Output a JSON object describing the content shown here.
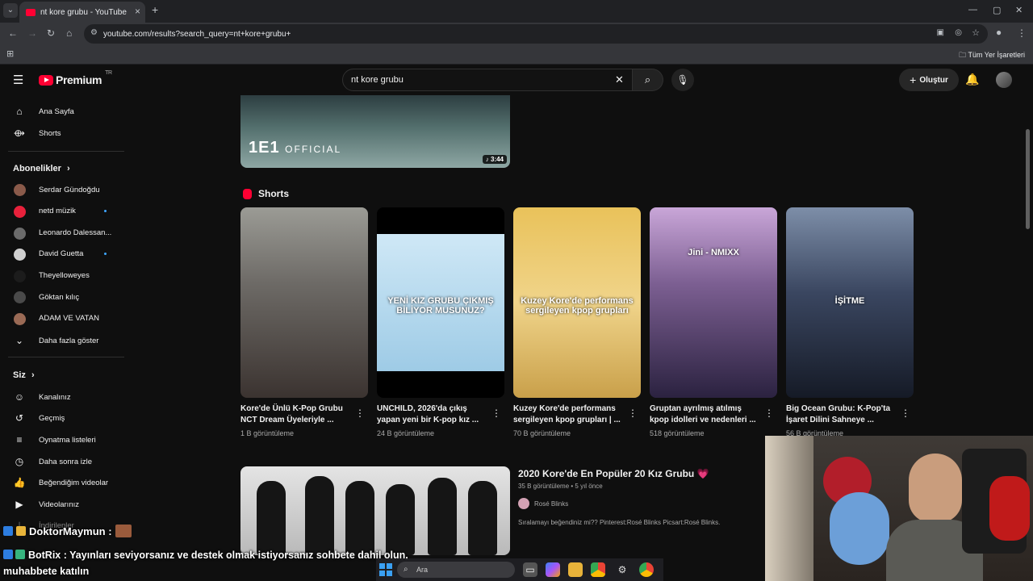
{
  "browser": {
    "tab_title": "nt kore grubu - YouTube",
    "new_tab": "+",
    "url": "youtube.com/results?search_query=nt+kore+grubu+",
    "bookmarks_all": "Tüm Yer İşaretleri"
  },
  "masthead": {
    "logo_text": "Premium",
    "logo_sup": "TR",
    "search_value": "nt kore grubu",
    "create_label": "Oluştur"
  },
  "sidebar": {
    "main": [
      {
        "label": "Ana Sayfa",
        "icon": "home-icon"
      },
      {
        "label": "Shorts",
        "icon": "shorts-icon"
      }
    ],
    "subs_title": "Abonelikler",
    "subscriptions": [
      {
        "label": "Serdar Gündoğdu",
        "color": "#8a5a4a",
        "dot": false
      },
      {
        "label": "netd müzik",
        "color": "#e8213b",
        "dot": true
      },
      {
        "label": "Leonardo Dalessan...",
        "color": "#6b6b6b",
        "dot": false
      },
      {
        "label": "David Guetta",
        "color": "#d0d0d0",
        "dot": true
      },
      {
        "label": "Theyelloweyes",
        "color": "#1c1c1c",
        "dot": false
      },
      {
        "label": "Göktan kılıç",
        "color": "#4a4a4a",
        "dot": false
      },
      {
        "label": "ADAM VE VATAN",
        "color": "#9a6a55",
        "dot": false
      }
    ],
    "show_more": "Daha fazla göster",
    "you_title": "Siz",
    "you": [
      {
        "label": "Kanalınız",
        "icon": "channel-icon"
      },
      {
        "label": "Geçmiş",
        "icon": "history-icon"
      },
      {
        "label": "Oynatma listeleri",
        "icon": "playlist-icon"
      },
      {
        "label": "Daha sonra izle",
        "icon": "watch-later-icon"
      },
      {
        "label": "Beğendiğim videolar",
        "icon": "like-icon"
      },
      {
        "label": "Videolarınız",
        "icon": "your-videos-icon"
      },
      {
        "label": "İndirilenler",
        "icon": "download-icon"
      }
    ]
  },
  "top_video": {
    "brand": "1E1",
    "brand_sub": "OFFICIAL",
    "duration": "♪ 3:44"
  },
  "shorts": {
    "heading": "Shorts",
    "items": [
      {
        "title": "Kore'de Ünlü K-Pop Grubu NCT Dream Üyeleriyle ...",
        "views": "1 B görüntüleme",
        "caption": "",
        "bg": "linear-gradient(180deg,#9b9b95 0%,#6d6a66 40%,#3b3330 100%)"
      },
      {
        "title": "UNCHILD, 2026'da çıkış yapan yeni bir K-pop kız ...",
        "views": "24 B görüntüleme",
        "caption": "YENİ KIZ GRUBU ÇIKMIŞ BİLİYOR MUSUNUZ?",
        "bg": "linear-gradient(180deg,#000 0%,#000 14%,#cfe8f6 14%,#9ecbe6 86%,#000 86%)"
      },
      {
        "title": "Kuzey Kore'de performans sergileyen kpop grupları | ...",
        "views": "70 B görüntüleme",
        "caption": "Kuzey Kore'de performans sergileyen kpop grupları",
        "bg": "linear-gradient(180deg,#e9c25a 0%,#f0d48a 50%,#c9a04a 100%)"
      },
      {
        "title": "Gruptan ayrılmış atılmış kpop idolleri ve nedenleri ...",
        "views": "518 görüntüleme",
        "caption": "Jini - NMIXX",
        "bg": "linear-gradient(180deg,#c9a6d8 0%,#7c5f92 40%,#2b2240 100%)"
      },
      {
        "title": "Big Ocean Grubu: K-Pop'ta İşaret Dilini Sahneye ...",
        "views": "56 B görüntüleme",
        "caption": "İŞİTME",
        "bg": "linear-gradient(180deg,#7d8ea8 0%,#3a4660 45%,#151a26 100%)"
      }
    ]
  },
  "video": {
    "title": "2020 Kore'de En Popüler 20 Kız Grubu 💗",
    "views": "35 B görüntüleme",
    "age": "5 yıl önce",
    "channel": "Rosé Blinks",
    "desc": "Sıralamayı beğendiniz mi?? Pinterest:Rosé Blinks Picsart:Rosé Blinks."
  },
  "chat": {
    "user1": "DoktorMaymun :",
    "user2": "BotRix :",
    "message": "Yayınları seviyorsanız ve destek olmak istiyorsanız sohbete dahil olun, muhabbete katılın"
  },
  "taskbar": {
    "search_placeholder": "Ara"
  }
}
